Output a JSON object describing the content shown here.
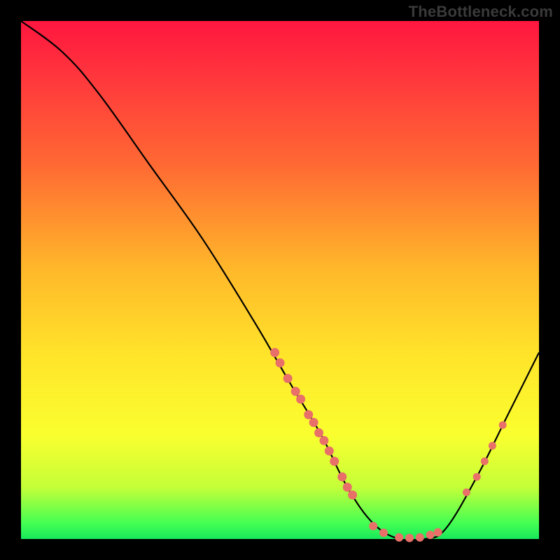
{
  "watermark": "TheBottleneck.com",
  "chart_data": {
    "type": "line",
    "title": "",
    "xlabel": "",
    "ylabel": "",
    "xlim": [
      0,
      100
    ],
    "ylim": [
      0,
      100
    ],
    "curve": [
      {
        "x": 0,
        "y": 100
      },
      {
        "x": 8,
        "y": 94
      },
      {
        "x": 15,
        "y": 86
      },
      {
        "x": 25,
        "y": 72
      },
      {
        "x": 35,
        "y": 58
      },
      {
        "x": 45,
        "y": 42
      },
      {
        "x": 52,
        "y": 30
      },
      {
        "x": 58,
        "y": 20
      },
      {
        "x": 63,
        "y": 10
      },
      {
        "x": 68,
        "y": 3
      },
      {
        "x": 73,
        "y": 0
      },
      {
        "x": 78,
        "y": 0
      },
      {
        "x": 82,
        "y": 2
      },
      {
        "x": 88,
        "y": 12
      },
      {
        "x": 94,
        "y": 24
      },
      {
        "x": 100,
        "y": 36
      }
    ],
    "points_left": [
      {
        "x": 49,
        "y": 36
      },
      {
        "x": 50,
        "y": 34
      },
      {
        "x": 51.5,
        "y": 31
      },
      {
        "x": 53,
        "y": 28.5
      },
      {
        "x": 54,
        "y": 27
      },
      {
        "x": 55.5,
        "y": 24
      },
      {
        "x": 56.5,
        "y": 22.5
      },
      {
        "x": 57.5,
        "y": 20.5
      },
      {
        "x": 58.5,
        "y": 19
      },
      {
        "x": 59.5,
        "y": 17
      },
      {
        "x": 60.5,
        "y": 15
      },
      {
        "x": 62,
        "y": 12
      },
      {
        "x": 63,
        "y": 10
      },
      {
        "x": 64,
        "y": 8.5
      }
    ],
    "points_bottom": [
      {
        "x": 68,
        "y": 2.5
      },
      {
        "x": 70,
        "y": 1.2
      },
      {
        "x": 73,
        "y": 0.3
      },
      {
        "x": 75,
        "y": 0.2
      },
      {
        "x": 77,
        "y": 0.3
      },
      {
        "x": 79,
        "y": 0.8
      },
      {
        "x": 80.5,
        "y": 1.3
      }
    ],
    "points_right": [
      {
        "x": 86,
        "y": 9
      },
      {
        "x": 88,
        "y": 12
      },
      {
        "x": 89.5,
        "y": 15
      },
      {
        "x": 91,
        "y": 18
      },
      {
        "x": 93,
        "y": 22
      }
    ]
  }
}
